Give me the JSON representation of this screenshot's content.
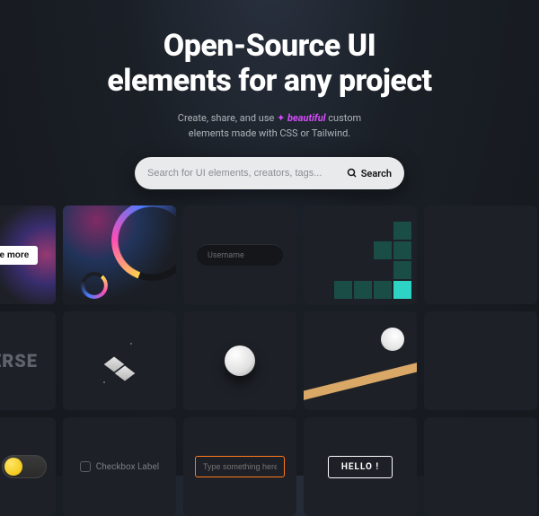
{
  "hero": {
    "title_line1": "Open-Source UI",
    "title_line2": "elements for any project",
    "subtitle_pre": "Create, share, and use ",
    "subtitle_highlight": "beautiful",
    "subtitle_post": " custom",
    "subtitle_line2": "elements made with CSS or Tailwind."
  },
  "search": {
    "placeholder": "Search for UI elements, creators, tags...",
    "button_label": "Search"
  },
  "cards": {
    "seemore_label": "ee more",
    "username_placeholder": "Username",
    "erse_text": "ERSE",
    "checkbox_label": "Checkbox Label",
    "input_placeholder": "Type something here",
    "hello_label": "HELLO !"
  }
}
